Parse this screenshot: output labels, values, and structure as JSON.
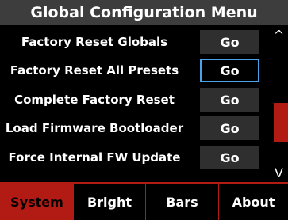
{
  "header": {
    "title": "Global Configuration Menu"
  },
  "menu": {
    "items": [
      {
        "label": "Factory Reset Globals",
        "button_label": "Go",
        "selected": false
      },
      {
        "label": "Factory Reset All Presets",
        "button_label": "Go",
        "selected": true
      },
      {
        "label": "Complete Factory Reset",
        "button_label": "Go",
        "selected": false
      },
      {
        "label": "Load Firmware Bootloader",
        "button_label": "Go",
        "selected": false
      },
      {
        "label": "Force Internal FW Update",
        "button_label": "Go",
        "selected": false
      }
    ]
  },
  "scrollbar": {
    "up_icon": "^",
    "down_icon": "V",
    "position_fraction": 0.74,
    "visible_fraction": 0.33
  },
  "tabs": [
    {
      "label": "System",
      "active": true
    },
    {
      "label": "Bright",
      "active": false
    },
    {
      "label": "Bars",
      "active": false
    },
    {
      "label": "About",
      "active": false
    }
  ],
  "colors": {
    "accent": "#b21a14",
    "selection": "#4aa3e6",
    "title_bg": "#3d3d3d",
    "button_bg": "#2f2f2f"
  }
}
